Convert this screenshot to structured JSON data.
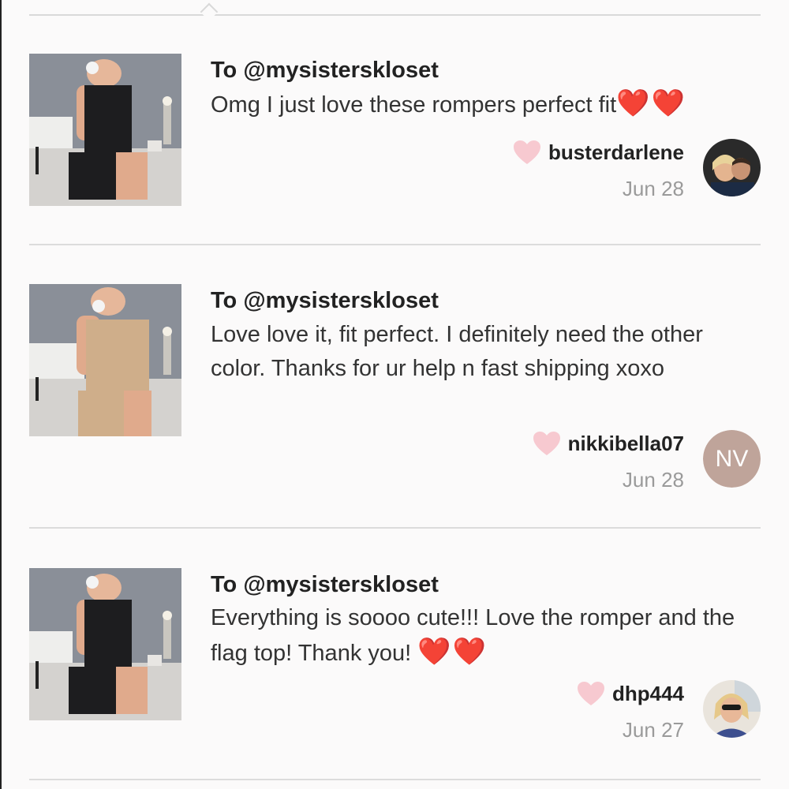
{
  "reviews": [
    {
      "to": "To @mysisterskloset",
      "text": "Omg I just love these rompers perfect fit",
      "hearts": "❤️❤️",
      "username": "busterdarlene",
      "date": "Jun 28",
      "avatar_type": "photo",
      "romper_color": "#1d1d1f"
    },
    {
      "to": "To @mysisterskloset",
      "text": "Love love it, fit perfect. I definitely need the other color. Thanks for ur help n fast shipping xoxo",
      "hearts": "",
      "username": "nikkibella07",
      "date": "Jun 28",
      "avatar_type": "initials",
      "avatar_initials": "NV",
      "romper_color": "#cfae8a"
    },
    {
      "to": "To @mysisterskloset",
      "text": "Everything is soooo cute!!! Love the romper and the flag top! Thank you!",
      "hearts": "❤️❤️",
      "username": "dhp444",
      "date": "Jun 27",
      "avatar_type": "photo",
      "romper_color": "#1d1d1f"
    }
  ],
  "colors": {
    "like_heart": "#f7c9d0",
    "avatar_initials_bg": "#bfa49a",
    "divider": "#dcdcdc"
  }
}
